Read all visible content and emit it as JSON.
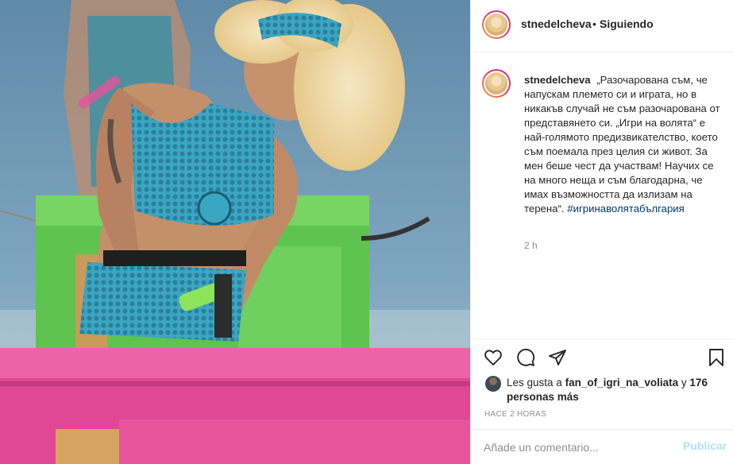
{
  "post": {
    "username": "stnedelcheva",
    "separator": "•",
    "follow_state": "Siguiendo",
    "caption_text": "„Разочарована съм, че напускам племето си и играта, но в никакъв случай не съм разочарована от представянето си. „Игри на волята“ е най-голямото предизвикателство, което съм поемала през целия си живот. За мен беше чест да участвам! Научих се на много неща и съм благодарна, че имах възможността да излизам на терена“.",
    "hashtag": "#игринаволятабългария",
    "time_ago": "2 h"
  },
  "likes": {
    "prefix": "Les gusta a",
    "user": "fan_of_igri_na_voliata",
    "connector": "y",
    "others": "176 personas más"
  },
  "posted_label": "HACE 2 HORAS",
  "comment": {
    "placeholder": "Añade un comentario...",
    "publish_label": "Publicar"
  },
  "icons": {
    "like": "heart-icon",
    "comment": "comment-bubble-icon",
    "share": "paper-plane-icon",
    "save": "bookmark-icon"
  },
  "colors": {
    "text": "#262626",
    "muted": "#8e8e8e",
    "hashtag": "#00376b",
    "publish_disabled": "#b2dffc",
    "divider": "#efefef"
  }
}
